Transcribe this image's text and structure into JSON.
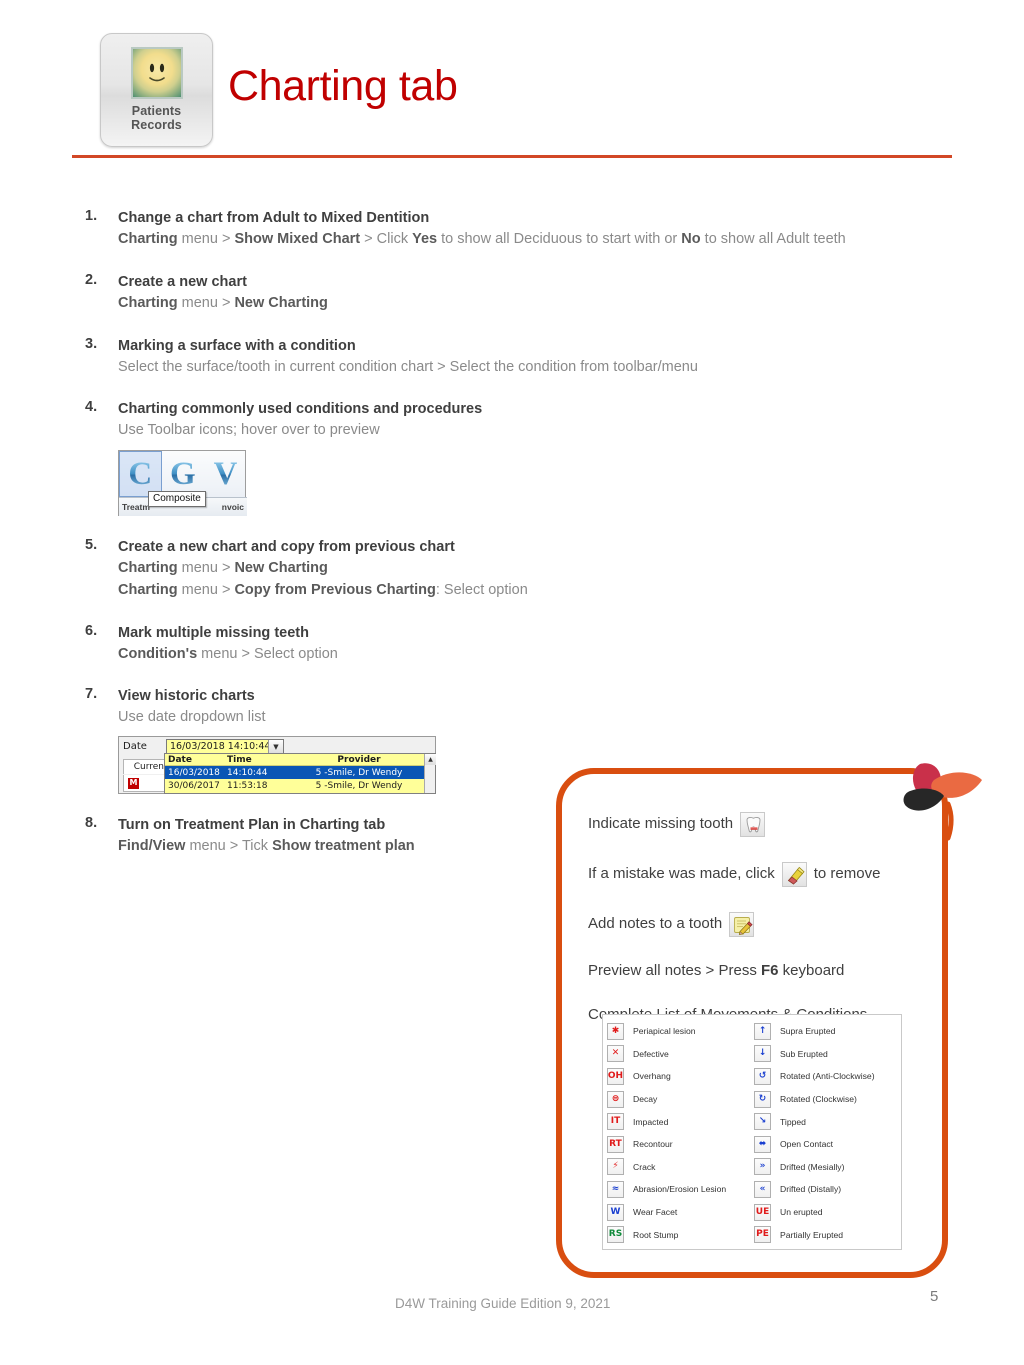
{
  "header": {
    "app_tile": {
      "icon": "smiley-face-icon",
      "label_line1": "Patients",
      "label_line2": "Records"
    },
    "title": "Charting tab",
    "accent_color": "#c00000",
    "rule_color": "#d24726"
  },
  "steps": [
    {
      "num": "1.",
      "title": "Change a chart from Adult to Mixed Dentition",
      "lines": [
        [
          {
            "t": "Charting",
            "b": true
          },
          {
            "t": " menu > ",
            "b": false
          },
          {
            "t": "Show Mixed Chart",
            "b": true
          },
          {
            "t": " > Click ",
            "b": false
          },
          {
            "t": "Yes",
            "b": true
          },
          {
            "t": " to show all Deciduous to start with or ",
            "b": false
          },
          {
            "t": "No",
            "b": true
          },
          {
            "t": " to show all Adult teeth",
            "b": false
          }
        ]
      ]
    },
    {
      "num": "2.",
      "title": "Create a new chart",
      "lines": [
        [
          {
            "t": "Charting",
            "b": true
          },
          {
            "t": " menu > ",
            "b": false
          },
          {
            "t": "New Charting",
            "b": true
          }
        ]
      ]
    },
    {
      "num": "3.",
      "title": "Marking a surface with a condition",
      "lines": [
        [
          {
            "t": "Select the surface/tooth in current condition chart > Select the condition from toolbar/menu",
            "b": false
          }
        ]
      ]
    },
    {
      "num": "4.",
      "title": "Charting commonly used conditions and procedures",
      "lines": [
        [
          {
            "t": "Use Toolbar icons; hover over to preview",
            "b": false
          }
        ]
      ]
    },
    {
      "num": "5.",
      "title": "Create a new chart and copy from previous chart",
      "lines": [
        [
          {
            "t": "Charting",
            "b": true
          },
          {
            "t": " menu > ",
            "b": false
          },
          {
            "t": "New Charting",
            "b": true
          }
        ],
        [
          {
            "t": "Charting",
            "b": true
          },
          {
            "t": " menu > ",
            "b": false
          },
          {
            "t": "Copy from Previous Charting",
            "b": true
          },
          {
            "t": ": Select option",
            "b": false
          }
        ]
      ]
    },
    {
      "num": "6.",
      "title": "Mark multiple missing teeth",
      "lines": [
        [
          {
            "t": "Condition's",
            "b": true
          },
          {
            "t": " menu > Select option",
            "b": false
          }
        ]
      ]
    },
    {
      "num": "7.",
      "title": "View historic charts",
      "lines": [
        [
          {
            "t": "Use date dropdown list",
            "b": false
          }
        ]
      ]
    },
    {
      "num": "8.",
      "title": "Turn on Treatment Plan in Charting tab",
      "lines": [
        [
          {
            "t": "Find/View",
            "b": true
          },
          {
            "t": " menu > Tick ",
            "b": false
          },
          {
            "t": "Show treatment plan",
            "b": true
          }
        ]
      ]
    }
  ],
  "cgv_toolbar": {
    "letters": [
      "C",
      "G",
      "V"
    ],
    "selected_letter": "C",
    "tooltip": "Composite",
    "left_caption": "Treatm",
    "right_caption": "nvoic"
  },
  "date_widget": {
    "label": "Date",
    "combo_value": "16/03/2018 14:10:44",
    "current_cell": "Curren",
    "columns": [
      "Date",
      "Time",
      "Provider"
    ],
    "rows": [
      {
        "date": "16/03/2018",
        "time": "14:10:44",
        "provider": "5 -Smile, Dr Wendy",
        "selected": true
      },
      {
        "date": "30/06/2017",
        "time": "11:53:18",
        "provider": "5 -Smile, Dr Wendy",
        "selected": false
      }
    ]
  },
  "callout": {
    "border_color": "#d94e10",
    "lines": [
      {
        "parts": [
          {
            "t": "Indicate missing tooth",
            "b": false
          }
        ],
        "icon_after": "missing-tooth-icon",
        "icon_kind": "tooth",
        "trailing": ""
      },
      {
        "parts": [
          {
            "t": "If a mistake was made, click",
            "b": false
          }
        ],
        "icon_after": "eraser-icon",
        "icon_kind": "eraser",
        "trailing": "to remove"
      },
      {
        "parts": [
          {
            "t": "Add notes to a tooth",
            "b": false
          }
        ],
        "icon_after": "note-pencil-icon",
        "icon_kind": "note",
        "trailing": ""
      },
      {
        "parts": [
          {
            "t": "Preview all notes > Press ",
            "b": false
          },
          {
            "t": "F6",
            "b": true
          },
          {
            "t": " keyboard",
            "b": false
          }
        ],
        "icon_after": null,
        "icon_kind": null,
        "trailing": ""
      },
      {
        "parts": [
          {
            "t": "Complete List of Movements & Conditions",
            "b": false
          }
        ],
        "icon_after": null,
        "icon_kind": null,
        "trailing": ""
      }
    ],
    "conditions_left": [
      {
        "glyph": "✱",
        "color": "red",
        "label": "Periapical lesion"
      },
      {
        "glyph": "✕",
        "color": "red",
        "label": "Defective"
      },
      {
        "glyph": "OH",
        "color": "red",
        "label": "Overhang"
      },
      {
        "glyph": "⊜",
        "color": "red",
        "label": "Decay"
      },
      {
        "glyph": "IT",
        "color": "red",
        "label": "Impacted"
      },
      {
        "glyph": "RT",
        "color": "red",
        "label": "Recontour"
      },
      {
        "glyph": "⚡",
        "color": "red",
        "label": "Crack"
      },
      {
        "glyph": "≈",
        "color": "blue",
        "label": "Abrasion/Erosion Lesion"
      },
      {
        "glyph": "W",
        "color": "blue",
        "label": "Wear Facet"
      },
      {
        "glyph": "RS",
        "color": "green",
        "label": "Root Stump"
      }
    ],
    "conditions_right": [
      {
        "glyph": "↑",
        "color": "blue",
        "label": "Supra Erupted"
      },
      {
        "glyph": "↓",
        "color": "blue",
        "label": "Sub Erupted"
      },
      {
        "glyph": "↺",
        "color": "blue",
        "label": "Rotated (Anti-Clockwise)"
      },
      {
        "glyph": "↻",
        "color": "blue",
        "label": "Rotated (Clockwise)"
      },
      {
        "glyph": "↘",
        "color": "blue",
        "label": "Tipped"
      },
      {
        "glyph": "⬌",
        "color": "blue",
        "label": "Open Contact"
      },
      {
        "glyph": "»",
        "color": "blue",
        "label": "Drifted (Mesially)"
      },
      {
        "glyph": "«",
        "color": "blue",
        "label": "Drifted (Distally)"
      },
      {
        "glyph": "UE",
        "color": "red",
        "label": "Un erupted"
      },
      {
        "glyph": "PE",
        "color": "red",
        "label": "Partially Erupted"
      }
    ]
  },
  "footer": {
    "text": "D4W Training Guide Edition 9, 2021",
    "page_number": "5"
  }
}
